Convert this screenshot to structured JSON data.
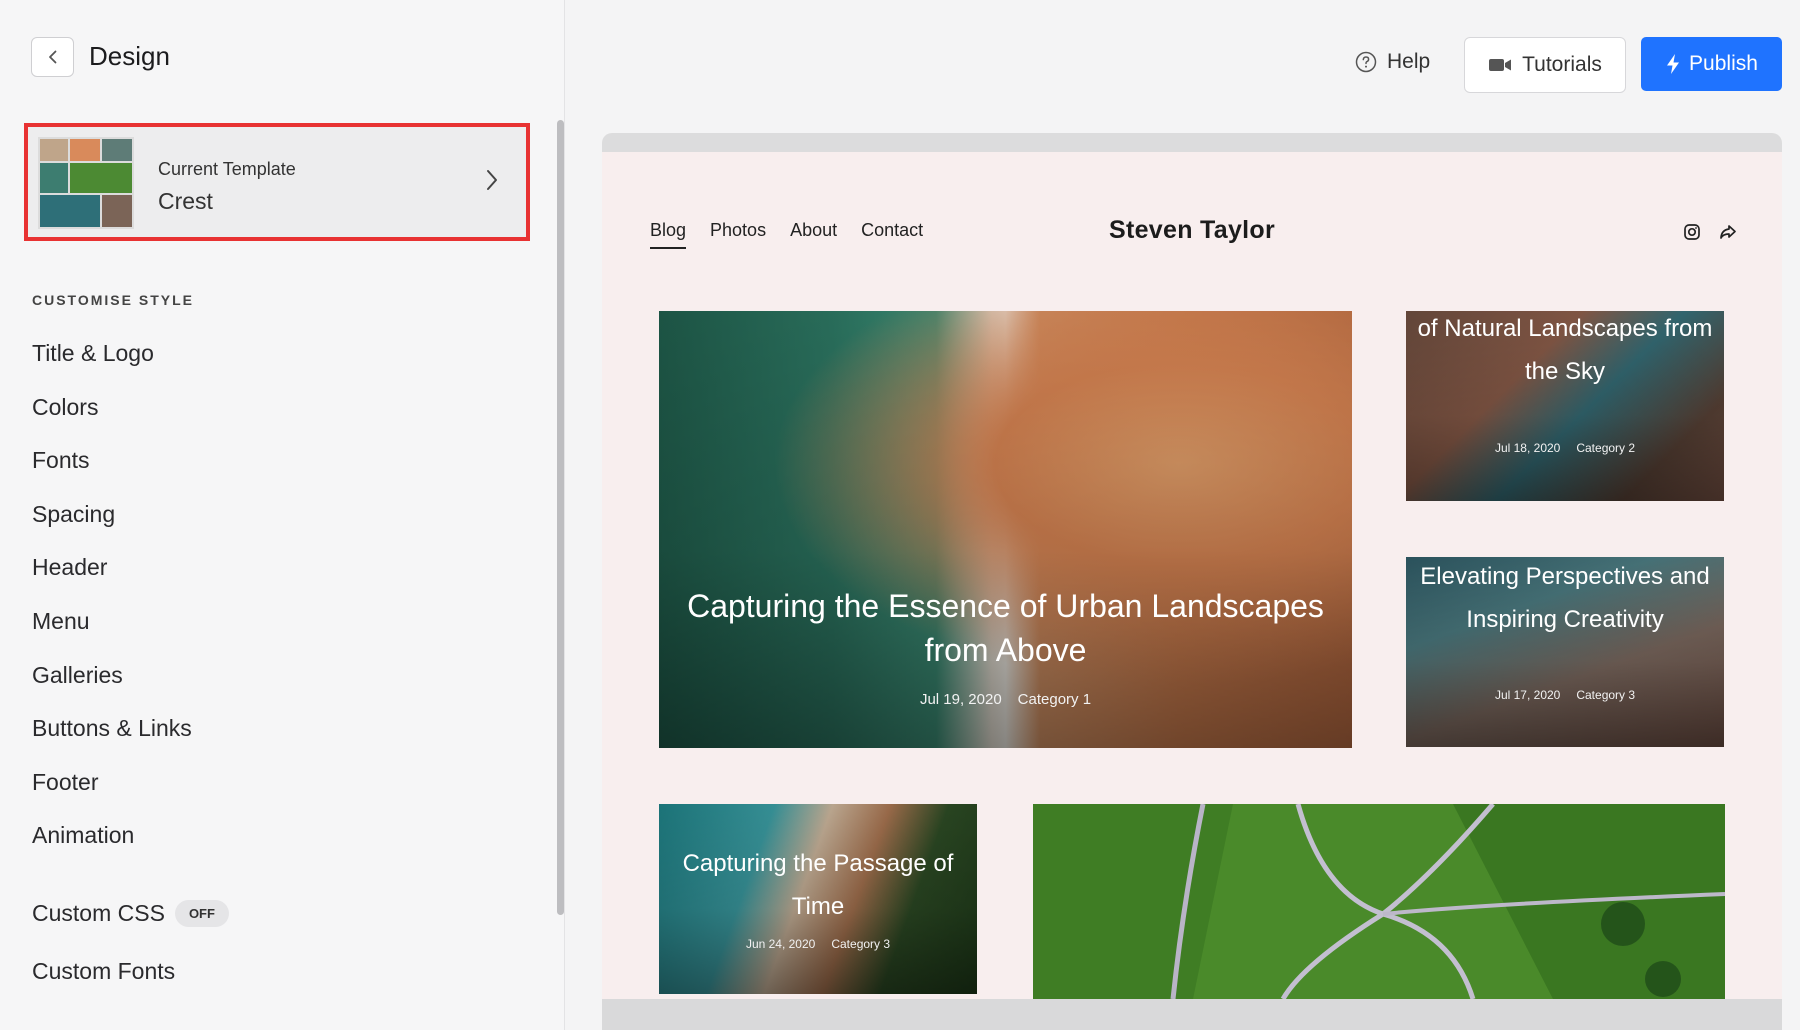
{
  "sidebar": {
    "title": "Design",
    "template": {
      "label": "Current Template",
      "name": "Crest"
    },
    "section_title": "CUSTOMISE STYLE",
    "items": [
      "Title & Logo",
      "Colors",
      "Fonts",
      "Spacing",
      "Header",
      "Menu",
      "Galleries",
      "Buttons & Links",
      "Footer",
      "Animation"
    ],
    "custom_css": {
      "label": "Custom CSS",
      "badge": "OFF"
    },
    "custom_fonts": "Custom Fonts"
  },
  "topbar": {
    "help": "Help",
    "tutorials": "Tutorials",
    "publish": "Publish",
    "accent_color": "#1f73ff"
  },
  "preview": {
    "nav": [
      "Blog",
      "Photos",
      "About",
      "Contact"
    ],
    "site_title": "Steven Taylor",
    "posts": [
      {
        "title": "Capturing the Essence of Urban Landscapes from Above",
        "date": "Jul 19, 2020",
        "category": "Category 1"
      },
      {
        "title": "of Natural Landscapes from the Sky",
        "date": "Jul 18, 2020",
        "category": "Category 2"
      },
      {
        "title": "Elevating Perspectives and Inspiring Creativity",
        "date": "Jul 17, 2020",
        "category": "Category 3"
      },
      {
        "title": "Capturing the Passage of Time",
        "date": "Jun 24, 2020",
        "category": "Category 3"
      }
    ]
  },
  "icons": [
    "chevron-left-icon",
    "chevron-right-icon",
    "help-circle-icon",
    "video-camera-icon",
    "lightning-icon",
    "instagram-icon",
    "share-icon"
  ]
}
